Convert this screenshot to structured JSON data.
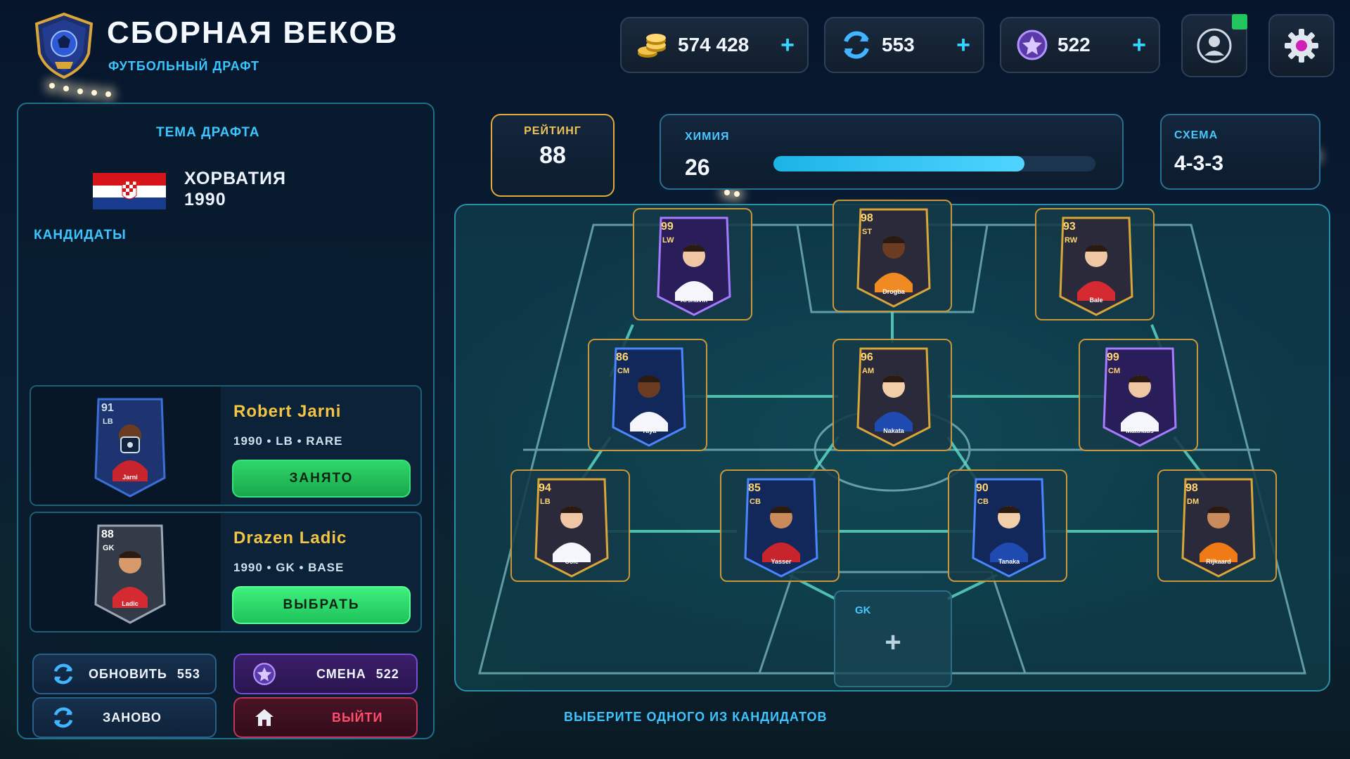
{
  "header": {
    "title": "СБОРНАЯ ВЕКОВ",
    "subtitle": "ФУТБОЛЬНЫЙ ДРАФТ",
    "logo_icon": "trophy-ball-shield-icon"
  },
  "currencies": [
    {
      "icon": "coins-icon",
      "value": "574 428",
      "plus": "+"
    },
    {
      "icon": "refresh-icon",
      "value": "553",
      "plus": "+"
    },
    {
      "icon": "star-token-icon",
      "value": "522",
      "plus": "+"
    }
  ],
  "top_buttons": {
    "profile_icon": "user-icon",
    "settings_icon": "gear-icon",
    "notification_color": "#22c55e"
  },
  "draft": {
    "theme_label": "ТЕМА ДРАФТА",
    "country": "ХОРВАТИЯ",
    "year": "1990",
    "candidates_label": "КАНДИДАТЫ",
    "candidates": [
      {
        "rating": "91",
        "pos": "LB",
        "card_name": "Jarni",
        "name": "Robert Jarni",
        "meta": "1990 • LB • RARE",
        "button": "ЗАНЯТО",
        "locked": true
      },
      {
        "rating": "88",
        "pos": "GK",
        "card_name": "Ladic",
        "name": "Drazen Ladic",
        "meta": "1990 • GK • BASE",
        "button": "ВЫБРАТЬ",
        "locked": false
      }
    ],
    "actions": {
      "refresh": {
        "label": "ОБНОВИТЬ",
        "count": "553"
      },
      "swap": {
        "label": "СМЕНА",
        "count": "522"
      },
      "restart": {
        "label": "ЗАНОВО"
      },
      "exit": {
        "label": "ВЫЙТИ"
      }
    }
  },
  "stats": {
    "rating": {
      "label": "РЕЙТИНГ",
      "value": "88"
    },
    "chemistry": {
      "label": "ХИМИЯ",
      "value": "26",
      "fill": 0.78
    },
    "schema": {
      "label": "СХЕМА",
      "value": "4-3-3"
    }
  },
  "squad": {
    "forwards": [
      {
        "rating": "99",
        "pos": "LW",
        "name": "Arshavin",
        "tier": "purple"
      },
      {
        "rating": "98",
        "pos": "ST",
        "name": "Drogba",
        "tier": "gold"
      },
      {
        "rating": "93",
        "pos": "RW",
        "name": "Bale",
        "tier": "gold"
      }
    ],
    "midfield": [
      {
        "rating": "86",
        "pos": "CM",
        "name": "Yaya",
        "tier": "blue"
      },
      {
        "rating": "96",
        "pos": "AM",
        "name": "Nakata",
        "tier": "gold"
      },
      {
        "rating": "99",
        "pos": "CM",
        "name": "Matthaus",
        "tier": "purple"
      }
    ],
    "defence": [
      {
        "rating": "94",
        "pos": "LB",
        "name": "Cole",
        "tier": "gold"
      },
      {
        "rating": "85",
        "pos": "CB",
        "name": "Yasser",
        "tier": "blue"
      },
      {
        "rating": "90",
        "pos": "CB",
        "name": "Tanaka",
        "tier": "blue"
      },
      {
        "rating": "98",
        "pos": "DM",
        "name": "Rijkaard",
        "tier": "gold"
      }
    ],
    "goalkeeper": {
      "label": "GK",
      "plus": "+"
    }
  },
  "hint": "ВЫБЕРИТЕ ОДНОГО ИЗ КАНДИДАТОВ"
}
